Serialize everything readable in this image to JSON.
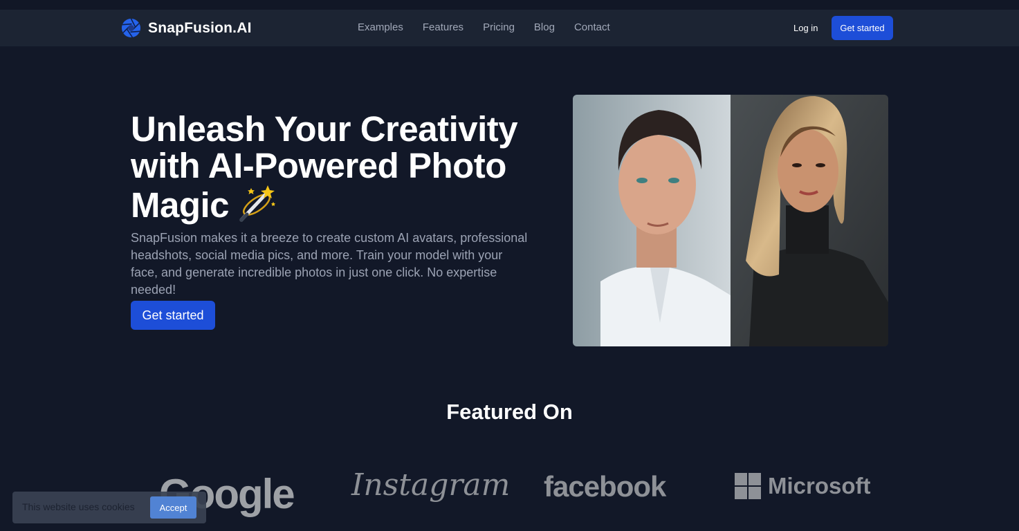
{
  "nav": {
    "brand": "SnapFusion.AI",
    "links": [
      "Examples",
      "Features",
      "Pricing",
      "Blog",
      "Contact"
    ],
    "login": "Log in",
    "cta": "Get started"
  },
  "hero": {
    "title": "Unleash Your Creativity with AI-Powered Photo Magic",
    "subtitle": "SnapFusion makes it a breeze to create custom AI avatars, professional headshots, social media pics, and more. Train your model with your face, and generate incredible photos in just one click. No expertise needed!",
    "cta": "Get started",
    "image_icon": "portrait-pair-image"
  },
  "featured": {
    "heading": "Featured On",
    "logos": [
      "Google",
      "Instagram",
      "facebook",
      "Microsoft"
    ]
  },
  "cookie": {
    "text": "This website uses cookies",
    "accept": "Accept"
  },
  "colors": {
    "background": "#121828",
    "navbar": "#1c2433",
    "accent": "#1d4ed8",
    "muted_text": "#9ca3b4"
  }
}
